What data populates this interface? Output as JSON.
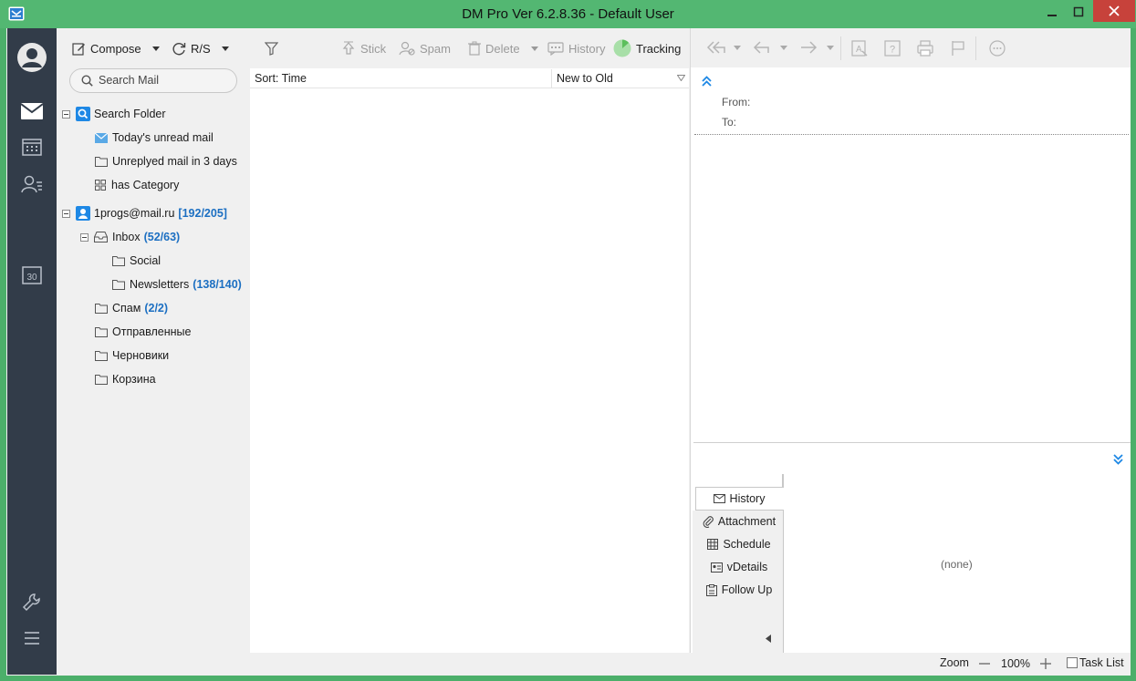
{
  "window": {
    "title": "DM Pro Ver 6.2.8.36  -  Default User"
  },
  "toolbar": {
    "compose": "Compose",
    "rs": "R/S",
    "stick": "Stick",
    "spam": "Spam",
    "delete": "Delete",
    "history": "History",
    "tracking": "Tracking"
  },
  "search": {
    "placeholder": "Search Mail"
  },
  "folders": {
    "search_folder": "Search Folder",
    "today_unread": "Today's unread mail",
    "unreplied": "Unreplyed mail in 3 days",
    "has_category": "has Category",
    "account": "1progs@mail.ru",
    "account_count": "[192/205]",
    "inbox": "Inbox",
    "inbox_count": "(52/63)",
    "social": "Social",
    "newsletters": "Newsletters",
    "newsletters_count": "(138/140)",
    "spam": "Спам",
    "spam_count": "(2/2)",
    "sent": "Отправленные",
    "drafts": "Черновики",
    "trash": "Корзина"
  },
  "list": {
    "sort_label": "Sort: Time",
    "sort_order": "New to Old"
  },
  "reading": {
    "from_label": "From:",
    "to_label": "To:",
    "tabs": [
      "History",
      "Attachment",
      "Schedule",
      "vDetails",
      "Follow Up"
    ],
    "empty_text": "(none)"
  },
  "status": {
    "zoom_label": "Zoom",
    "zoom_value": "100%",
    "task_list": "Task List"
  },
  "colors": {
    "window_accent": "#53b772",
    "rail": "#323c49",
    "count_blue": "#1c6fc2",
    "close_red": "#c7423b"
  }
}
